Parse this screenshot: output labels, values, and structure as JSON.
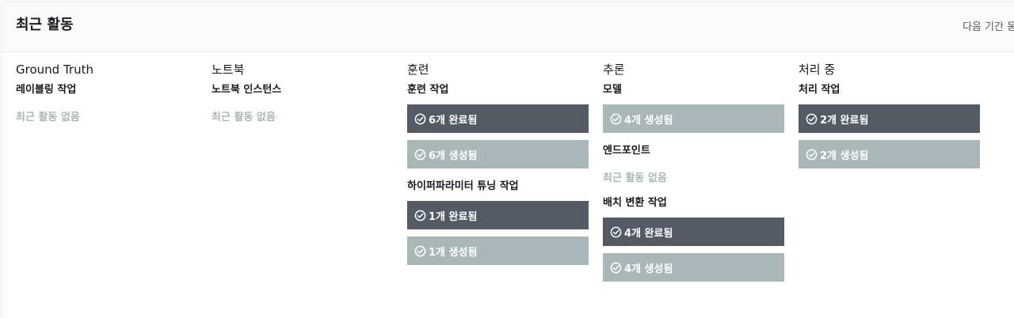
{
  "panel": {
    "title": "최근 활동",
    "period_label": "다음 기간 동"
  },
  "columns": [
    {
      "title": "Ground Truth",
      "sections": [
        {
          "title": "레이블링 작업",
          "empty": "최근 활동 없음",
          "items": []
        }
      ]
    },
    {
      "title": "노트북",
      "sections": [
        {
          "title": "노트북 인스턴스",
          "empty": "최근 활동 없음",
          "items": []
        }
      ]
    },
    {
      "title": "훈련",
      "sections": [
        {
          "title": "훈련 작업",
          "items": [
            {
              "label": "6개 완료됨",
              "status": "completed",
              "icon": "check-circle-icon"
            },
            {
              "label": "6개 생성됨",
              "status": "created",
              "icon": "check-circle-icon"
            }
          ]
        },
        {
          "title": "하이퍼파라미터 튜닝 작업",
          "items": [
            {
              "label": "1개 완료됨",
              "status": "completed",
              "icon": "check-circle-icon"
            },
            {
              "label": "1개 생성됨",
              "status": "created",
              "icon": "check-circle-icon"
            }
          ]
        }
      ]
    },
    {
      "title": "추론",
      "sections": [
        {
          "title": "모델",
          "items": [
            {
              "label": "4개 생성됨",
              "status": "created",
              "icon": "check-circle-icon"
            }
          ]
        },
        {
          "title": "엔드포인트",
          "empty": "최근 활동 없음",
          "items": []
        },
        {
          "title": "배치 변환 작업",
          "items": [
            {
              "label": "4개 완료됨",
              "status": "completed",
              "icon": "check-circle-icon"
            },
            {
              "label": "4개 생성됨",
              "status": "created",
              "icon": "check-circle-icon"
            }
          ]
        }
      ]
    },
    {
      "title": "처리 중",
      "sections": [
        {
          "title": "처리 작업",
          "items": [
            {
              "label": "2개 완료됨",
              "status": "completed",
              "icon": "check-circle-icon"
            },
            {
              "label": "2개 생성됨",
              "status": "created",
              "icon": "check-circle-icon"
            }
          ]
        }
      ]
    }
  ],
  "colors": {
    "completed": "#545b64",
    "created": "#aab7b8",
    "empty_text": "#aab7b8"
  }
}
